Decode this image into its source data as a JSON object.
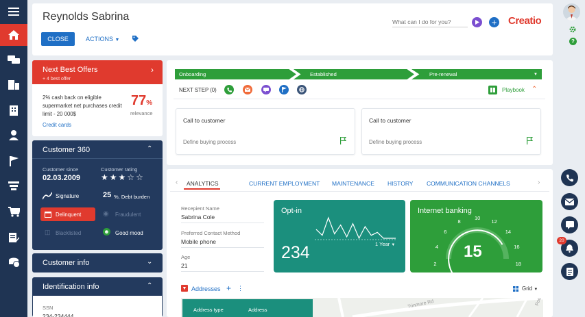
{
  "header": {
    "record_name": "Reynolds Sabrina",
    "close_label": "CLOSE",
    "actions_label": "ACTIONS",
    "search_placeholder": "What can I do for you?",
    "logo": "Creatio"
  },
  "next_best_offers": {
    "title": "Next Best Offers",
    "subtitle": "+ 4 best offer",
    "offer_text": "2% cash back on eligible supermarket net purchases credit limit - 20 000$",
    "percent": "77",
    "percent_unit": "%",
    "relevance_label": "relevance",
    "category": "Credit cards"
  },
  "customer360": {
    "title": "Customer 360",
    "since_label": "Customer since",
    "since_value": "02.03.2009",
    "rating_label": "Customer rating",
    "rating_value": 3,
    "rating_max": 5,
    "signature_label": "Signature",
    "debt_value": "25",
    "debt_label": "%, Debt burden",
    "delinquent_label": "Delinquent",
    "fraudulent_label": "Fraudulent",
    "blacklisted_label": "Blacklisted",
    "mood_label": "Good mood"
  },
  "customer_info": {
    "title": "Customer info"
  },
  "identification_info": {
    "title": "Identification info",
    "ssn_label": "SSN",
    "ssn_value": "234-234444"
  },
  "stages": [
    "Onboarding",
    "Established",
    "Pre-renewal"
  ],
  "next_step": {
    "label": "NEXT STEP (0)",
    "playbook_label": "Playbook"
  },
  "tasks": [
    {
      "title": "Call to customer",
      "subtitle": "Define buying process"
    },
    {
      "title": "Call to customer",
      "subtitle": "Define buying process"
    }
  ],
  "tabs": [
    "ANALYTICS",
    "CURRENT EMPLOYMENT",
    "MAINTENANCE",
    "HISTORY",
    "COMMUNICATION CHANNELS"
  ],
  "fields": [
    {
      "label": "Recepient Name",
      "value": "Sabrina Cole"
    },
    {
      "label": "Preferred Contact Method",
      "value": "Mobile phone"
    },
    {
      "label": "Age",
      "value": "21"
    }
  ],
  "optin": {
    "title": "Opt-in",
    "value": "234",
    "period": "1 Year",
    "sparkline": [
      18,
      14,
      26,
      15,
      21,
      13,
      22,
      12,
      20,
      14,
      16,
      12,
      12,
      12
    ]
  },
  "internet_banking": {
    "title": "Internet banking",
    "value": 15,
    "min": 0,
    "max": 20,
    "ticks": [
      "0",
      "2",
      "4",
      "6",
      "8",
      "10",
      "12",
      "14",
      "16",
      "18",
      "20"
    ]
  },
  "addresses": {
    "title": "Addresses",
    "view_label": "Grid",
    "columns": [
      "Address type",
      "Address"
    ],
    "map_labels": [
      "Trinmore Rd",
      "Poo"
    ]
  },
  "notifications": {
    "count": "20"
  },
  "colors": {
    "nav": "#1f3453",
    "accent_red": "#e03a2e",
    "green": "#2e9e3a",
    "teal": "#1b8f7d",
    "blue": "#1f6fc5"
  }
}
